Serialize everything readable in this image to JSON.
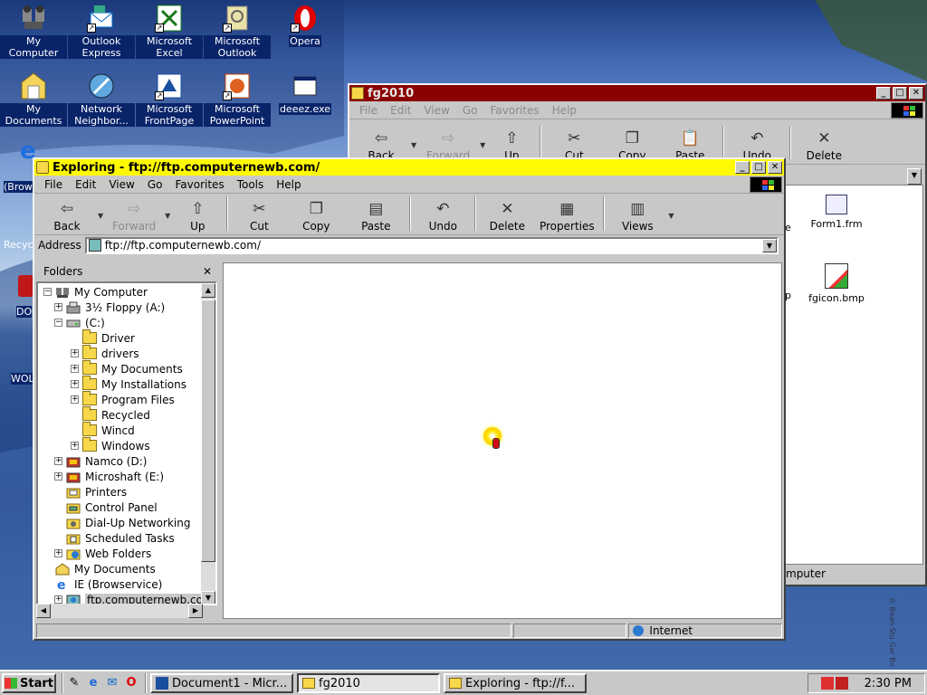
{
  "desktop": {
    "icons": [
      {
        "label": "My Computer"
      },
      {
        "label": "Outlook Express"
      },
      {
        "label": "Microsoft Excel"
      },
      {
        "label": "Microsoft Outlook"
      },
      {
        "label": "Opera"
      },
      {
        "label": "My Documents"
      },
      {
        "label": "Network Neighbor..."
      },
      {
        "label": "Microsoft FrontPage"
      },
      {
        "label": "Microsoft PowerPoint"
      },
      {
        "label": "deeez.exe"
      }
    ],
    "partial_labels": [
      "(Brow",
      "Recyc",
      "DO",
      "WOL"
    ],
    "watermark": "© Bean Stu Gar Bo"
  },
  "fg_window": {
    "title": "fg2010",
    "menu": [
      "File",
      "Edit",
      "View",
      "Go",
      "Favorites",
      "Help"
    ],
    "toolbar": [
      "Back",
      "Forward",
      "Up",
      "Cut",
      "Copy",
      "Paste",
      "Undo",
      "Delete"
    ],
    "files": [
      {
        "name": "Form1.frm"
      },
      {
        "name": "fgicon.bmp"
      }
    ],
    "status_right": "mputer"
  },
  "explorer": {
    "title": "Exploring - ftp://ftp.computernewb.com/",
    "menu": [
      "File",
      "Edit",
      "View",
      "Go",
      "Favorites",
      "Tools",
      "Help"
    ],
    "toolbar": {
      "back": "Back",
      "forward": "Forward",
      "up": "Up",
      "cut": "Cut",
      "copy": "Copy",
      "paste": "Paste",
      "undo": "Undo",
      "delete": "Delete",
      "properties": "Properties",
      "views": "Views"
    },
    "address_label": "Address",
    "address_value": "ftp://ftp.computernewb.com/",
    "folders_header": "Folders",
    "tree": [
      {
        "label": "My Computer",
        "level": 0,
        "exp": "-",
        "icon": "computer"
      },
      {
        "label": "3½ Floppy (A:)",
        "level": 1,
        "exp": "+",
        "icon": "floppy"
      },
      {
        "label": "(C:)",
        "level": 1,
        "exp": "-",
        "icon": "drive"
      },
      {
        "label": "Driver",
        "level": 2,
        "exp": "",
        "icon": "folder"
      },
      {
        "label": "drivers",
        "level": 2,
        "exp": "+",
        "icon": "folder"
      },
      {
        "label": "My Documents",
        "level": 2,
        "exp": "+",
        "icon": "folder"
      },
      {
        "label": "My Installations",
        "level": 2,
        "exp": "+",
        "icon": "folder"
      },
      {
        "label": "Program Files",
        "level": 2,
        "exp": "+",
        "icon": "folder"
      },
      {
        "label": "Recycled",
        "level": 2,
        "exp": "",
        "icon": "folder"
      },
      {
        "label": "Wincd",
        "level": 2,
        "exp": "",
        "icon": "folder"
      },
      {
        "label": "Windows",
        "level": 2,
        "exp": "+",
        "icon": "folder"
      },
      {
        "label": "Namco (D:)",
        "level": 1,
        "exp": "+",
        "icon": "cd"
      },
      {
        "label": "Microshaft (E:)",
        "level": 1,
        "exp": "+",
        "icon": "cd"
      },
      {
        "label": "Printers",
        "level": 1,
        "exp": "",
        "icon": "printer"
      },
      {
        "label": "Control Panel",
        "level": 1,
        "exp": "",
        "icon": "panel"
      },
      {
        "label": "Dial-Up Networking",
        "level": 1,
        "exp": "",
        "icon": "dialup"
      },
      {
        "label": "Scheduled Tasks",
        "level": 1,
        "exp": "",
        "icon": "tasks"
      },
      {
        "label": "Web Folders",
        "level": 1,
        "exp": "+",
        "icon": "web"
      },
      {
        "label": "My Documents",
        "level": 0,
        "exp": "",
        "icon": "docs"
      },
      {
        "label": "IE (Browservice)",
        "level": 0,
        "exp": "",
        "icon": "ie"
      },
      {
        "label": "ftp.computernewb.com",
        "level": 1,
        "exp": "+",
        "icon": "ftp",
        "selected": true
      }
    ],
    "status_zone": "Internet"
  },
  "taskbar": {
    "start": "Start",
    "tasks": [
      {
        "label": "Document1 - Micr...",
        "active": false
      },
      {
        "label": "fg2010",
        "active": true
      },
      {
        "label": "Exploring - ftp://f...",
        "active": false
      }
    ],
    "clock": "2:30 PM"
  },
  "colors": {
    "active_title": "#fffa00",
    "inactive_title": "#8b0000",
    "selection": "#0a246a",
    "face": "#c8c8c8"
  }
}
